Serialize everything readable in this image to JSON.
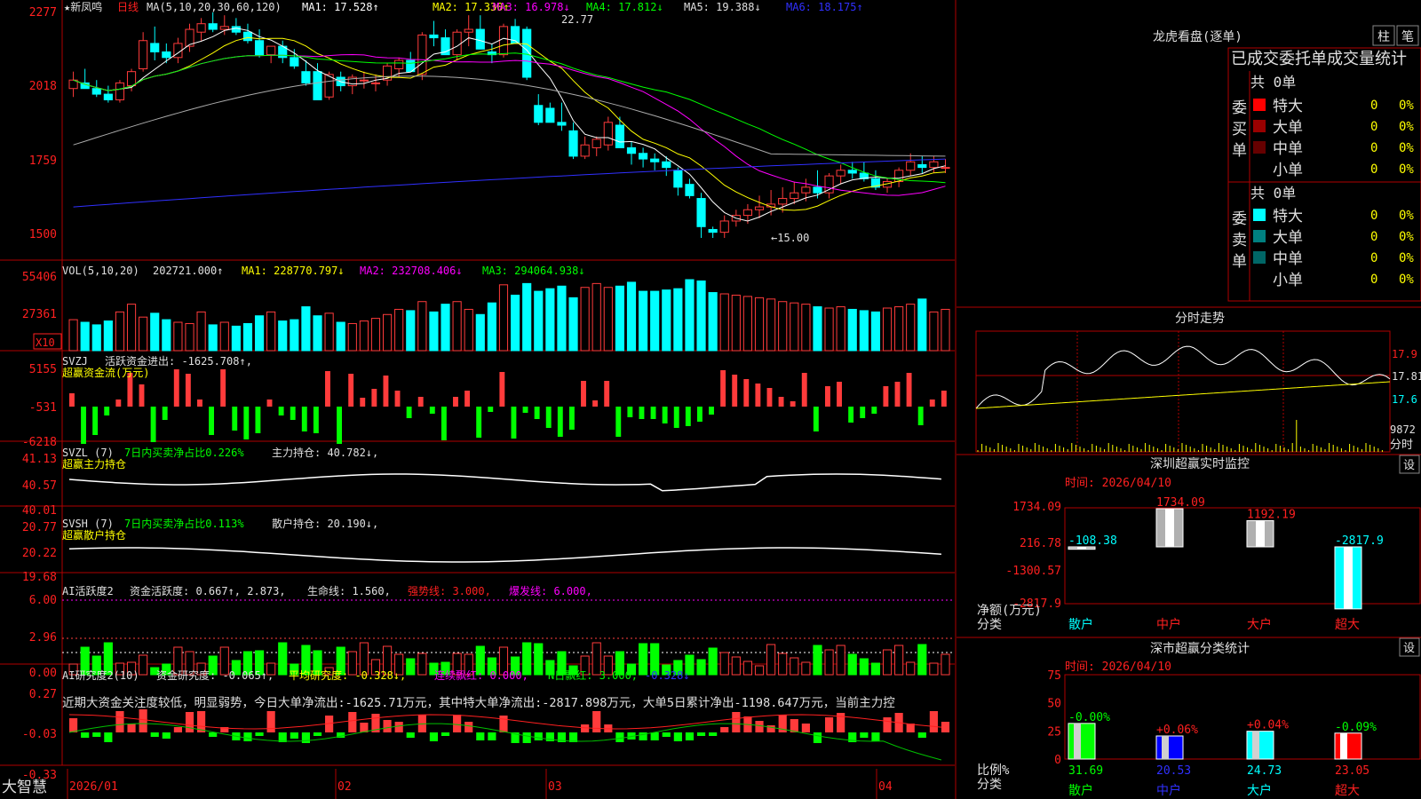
{
  "colors": {
    "up": "#ff3b3b",
    "down": "#00ffff",
    "grid": "#8b0000",
    "axis_text": "#ff2020",
    "white": "#ffffff",
    "yellow": "#ffff00",
    "magenta": "#ff00ff",
    "green": "#00ff00",
    "gray": "#aaaaaa",
    "blue": "#3030ff",
    "text": "#e0e0e0"
  },
  "stock": {
    "name": "★新凤鸣",
    "period": "日线"
  },
  "main_panel": {
    "ma_legend": [
      "MA(5,10,20,30,60,120)",
      "MA1: 17.528↑",
      "MA2: 17.330↑",
      "MA3: 16.978↓",
      "MA4: 17.812↓",
      "MA5: 19.388↓",
      "MA6: 18.175↑"
    ],
    "y_ticks": [
      "2277",
      "2018",
      "1759",
      "1500"
    ],
    "high_mark": "22.77",
    "low_mark": "←15.00"
  },
  "vol_panel": {
    "legend": [
      "VOL(5,10,20)",
      "202721.000↑",
      "MA1: 228770.797↓",
      "MA2: 232708.406↓",
      "MA3: 294064.938↓"
    ],
    "y_ticks": [
      "55406",
      "27361"
    ],
    "unit": "X10"
  },
  "svzj_panel": {
    "legend": [
      "SVZJ",
      "活跃资金进出: -1625.708↑,"
    ],
    "subtitle": "超赢资金流(万元)",
    "y_ticks": [
      "5155",
      "-531",
      "-6218"
    ]
  },
  "svzl_panel": {
    "legend": [
      "SVZL (7)",
      "7日内买卖净占比0.226%",
      "主力持仓: 40.782↓,"
    ],
    "subtitle": "超赢主力持仓",
    "y_ticks": [
      "41.13",
      "40.57",
      "40.01"
    ]
  },
  "svsh_panel": {
    "legend": [
      "SVSH (7)",
      "7日内买卖净占比0.113%",
      "散户持仓: 20.190↓,"
    ],
    "subtitle": "超赢散户持仓",
    "y_ticks": [
      "20.77",
      "20.22",
      "19.68"
    ]
  },
  "ai_active_panel": {
    "legend": [
      "AI活跃度2",
      "资金活跃度: 0.667↑, 2.873,",
      "生命线: 1.560,",
      "强势线: 3.000,",
      "爆发线: 6.000,"
    ],
    "y_ticks": [
      "6.00",
      "2.96",
      "0.00"
    ]
  },
  "ai_research_panel": {
    "legend": [
      "AI研究度2(10)",
      "资金研究度: -0.065↑,",
      "平均研究度: -0.328↓,",
      "连续飘红: 0.000,",
      "N日飘红: 3.000,",
      "-0.328↓"
    ],
    "commentary": "近期大资金关注度较低，明显弱势，今日大单净流出:-1625.71万元，其中特大单净流出:-2817.898万元，大单5日累计净出-1198.647万元，当前主力控",
    "y_ticks": [
      "0.27",
      "-0.03",
      "-0.33"
    ]
  },
  "x_axis": {
    "labels": [
      "2026/01",
      "02",
      "03",
      "04"
    ]
  },
  "footer": {
    "brand": "大智慧"
  },
  "dragon_tiger": {
    "title": "龙虎看盘(逐单)",
    "btn_bar": "柱",
    "btn_stroke": "笔",
    "header": "已成交委托单成交量统计",
    "buy": {
      "label": "委买单",
      "total": "共 0单",
      "rows": [
        {
          "name": "特大",
          "vol": "0",
          "pct": "0%",
          "color": "#ff0000"
        },
        {
          "name": "大单",
          "vol": "0",
          "pct": "0%",
          "color": "#990000"
        },
        {
          "name": "中单",
          "vol": "0",
          "pct": "0%",
          "color": "#660000"
        },
        {
          "name": "小单",
          "vol": "0",
          "pct": "0%",
          "color": "#000000"
        }
      ]
    },
    "sell": {
      "label": "委卖单",
      "total": "共 0单",
      "rows": [
        {
          "name": "特大",
          "vol": "0",
          "pct": "0%",
          "color": "#00ffff"
        },
        {
          "name": "大单",
          "vol": "0",
          "pct": "0%",
          "color": "#008080"
        },
        {
          "name": "中单",
          "vol": "0",
          "pct": "0%",
          "color": "#006666"
        },
        {
          "name": "小单",
          "vol": "0",
          "pct": "0%",
          "color": "#000000"
        }
      ]
    }
  },
  "intraday": {
    "title": "分时走势",
    "y_ticks": [
      "17.9",
      "17.81",
      "17.6"
    ],
    "vol_label": "9872",
    "x_label": "分时"
  },
  "sz_monitor": {
    "title": "深圳超赢实时监控",
    "settings": "设",
    "time": "时间: 2026/04/10",
    "y_ticks": [
      "1734.09",
      "216.78",
      "-1300.57",
      "-2817.9"
    ],
    "ylabel": "净额(万元)",
    "xlabel": "分类",
    "categories": [
      "散户",
      "中户",
      "大户",
      "超大"
    ],
    "values": [
      -108.38,
      1734.09,
      1192.19,
      -2817.9
    ],
    "value_labels": [
      "-108.38",
      "1734.09",
      "1192.19",
      "-2817.9"
    ]
  },
  "sz_class": {
    "title": "深市超赢分类统计",
    "settings": "设",
    "time": "时间: 2026/04/10",
    "y_ticks": [
      "75",
      "50",
      "25",
      "0"
    ],
    "ylabel": "比例%",
    "xlabel": "分类",
    "categories": [
      "散户",
      "中户",
      "大户",
      "超大"
    ],
    "values": [
      31.69,
      20.53,
      24.73,
      23.05
    ],
    "changes": [
      "-0.00%",
      "+0.06%",
      "+0.04%",
      "-0.09%"
    ],
    "colors": [
      "#00ff00",
      "#0000ff",
      "#00ffff",
      "#ff0000"
    ]
  },
  "chart_data": {
    "type": "candlestick",
    "title": "新凤鸣 日线",
    "ohlc": [
      [
        20.3,
        20.9,
        20.0,
        20.6
      ],
      [
        20.5,
        21.0,
        20.3,
        20.3
      ],
      [
        20.3,
        20.6,
        20.0,
        20.1
      ],
      [
        20.1,
        20.4,
        19.8,
        19.9
      ],
      [
        19.9,
        20.6,
        19.8,
        20.5
      ],
      [
        20.4,
        21.0,
        20.2,
        20.9
      ],
      [
        21.0,
        22.3,
        20.9,
        22.0
      ],
      [
        21.9,
        22.5,
        21.3,
        21.6
      ],
      [
        21.6,
        21.9,
        21.2,
        21.4
      ],
      [
        21.4,
        22.1,
        21.2,
        21.9
      ],
      [
        21.8,
        22.6,
        21.6,
        22.4
      ],
      [
        22.3,
        22.8,
        22.0,
        22.6
      ],
      [
        22.6,
        23.0,
        22.3,
        22.4
      ],
      [
        22.4,
        22.9,
        22.2,
        22.5
      ],
      [
        22.5,
        22.8,
        22.2,
        22.3
      ],
      [
        22.3,
        22.6,
        21.9,
        22.0
      ],
      [
        22.0,
        22.4,
        21.4,
        21.5
      ],
      [
        21.5,
        21.8,
        21.2,
        21.8
      ],
      [
        21.8,
        22.0,
        21.2,
        21.4
      ],
      [
        21.4,
        21.7,
        21.0,
        21.1
      ],
      [
        20.9,
        21.3,
        20.4,
        20.5
      ],
      [
        20.9,
        21.2,
        19.9,
        19.9
      ],
      [
        20.0,
        20.9,
        19.9,
        20.8
      ],
      [
        20.7,
        20.9,
        20.2,
        20.4
      ],
      [
        20.4,
        20.8,
        20.1,
        20.7
      ],
      [
        20.6,
        20.9,
        20.3,
        20.6
      ],
      [
        20.5,
        20.8,
        20.2,
        20.5
      ],
      [
        20.6,
        21.2,
        20.4,
        21.1
      ],
      [
        21.0,
        21.4,
        20.7,
        21.3
      ],
      [
        21.3,
        21.6,
        20.9,
        20.9
      ],
      [
        20.8,
        22.3,
        20.6,
        22.2
      ],
      [
        22.2,
        22.7,
        21.8,
        22.1
      ],
      [
        22.1,
        22.4,
        21.5,
        21.5
      ],
      [
        21.5,
        22.4,
        21.3,
        22.3
      ],
      [
        22.3,
        22.9,
        21.8,
        22.4
      ],
      [
        22.4,
        22.9,
        21.9,
        21.7
      ],
      [
        21.6,
        21.9,
        21.2,
        21.5
      ],
      [
        21.5,
        22.6,
        21.4,
        22.5
      ],
      [
        22.5,
        22.77,
        22.0,
        21.9
      ],
      [
        22.4,
        22.5,
        20.6,
        20.7
      ],
      [
        19.7,
        20.1,
        19.0,
        19.1
      ],
      [
        19.6,
        19.8,
        19.2,
        19.1
      ],
      [
        19.1,
        19.8,
        18.8,
        19.0
      ],
      [
        18.8,
        19.1,
        17.8,
        17.9
      ],
      [
        17.9,
        18.6,
        17.8,
        18.3
      ],
      [
        18.2,
        18.6,
        17.9,
        18.5
      ],
      [
        18.3,
        19.3,
        18.1,
        19.1
      ],
      [
        19.0,
        19.3,
        18.2,
        18.2
      ],
      [
        18.2,
        18.4,
        17.6,
        18.0
      ],
      [
        18.0,
        18.2,
        17.5,
        17.8
      ],
      [
        17.8,
        18.0,
        17.4,
        17.7
      ],
      [
        17.7,
        17.9,
        17.2,
        17.5
      ],
      [
        17.4,
        17.5,
        16.5,
        16.8
      ],
      [
        16.9,
        17.1,
        16.4,
        16.5
      ],
      [
        16.4,
        16.6,
        15.0,
        15.4
      ],
      [
        15.3,
        15.4,
        15.0,
        15.2
      ],
      [
        15.2,
        15.8,
        15.0,
        15.6
      ],
      [
        15.6,
        16.0,
        15.4,
        15.8
      ],
      [
        15.8,
        16.2,
        15.5,
        16.0
      ],
      [
        16.0,
        16.5,
        15.7,
        16.1
      ],
      [
        16.1,
        16.7,
        15.8,
        16.2
      ],
      [
        16.2,
        16.8,
        15.9,
        16.4
      ],
      [
        16.4,
        17.0,
        16.2,
        16.6
      ],
      [
        16.6,
        17.1,
        16.3,
        16.8
      ],
      [
        16.8,
        17.4,
        16.4,
        16.6
      ],
      [
        16.6,
        17.3,
        16.4,
        17.2
      ],
      [
        17.2,
        17.6,
        16.9,
        17.4
      ],
      [
        17.4,
        17.7,
        17.1,
        17.3
      ],
      [
        17.3,
        17.7,
        17.0,
        17.1
      ],
      [
        17.1,
        17.4,
        16.7,
        16.8
      ],
      [
        16.8,
        17.1,
        16.6,
        17.0
      ],
      [
        17.0,
        17.5,
        16.8,
        17.4
      ],
      [
        17.4,
        18.0,
        17.2,
        17.7
      ],
      [
        17.6,
        17.9,
        17.3,
        17.5
      ],
      [
        17.5,
        17.9,
        17.3,
        17.7
      ],
      [
        17.5,
        17.8,
        17.3,
        17.5
      ]
    ],
    "volume": [
      120,
      110,
      100,
      115,
      150,
      180,
      130,
      145,
      120,
      110,
      105,
      150,
      100,
      110,
      95,
      105,
      135,
      150,
      115,
      120,
      170,
      135,
      145,
      110,
      105,
      115,
      125,
      140,
      160,
      155,
      190,
      150,
      180,
      190,
      160,
      140,
      185,
      255,
      215,
      260,
      230,
      240,
      250,
      205,
      245,
      260,
      245,
      250,
      265,
      230,
      230,
      235,
      240,
      275,
      270,
      225,
      220,
      215,
      210,
      205,
      200,
      190,
      185,
      180,
      170,
      165,
      170,
      160,
      155,
      150,
      165,
      170,
      180,
      200,
      150,
      160
    ],
    "series_ma": {
      "ma5": "white",
      "ma10": "yellow",
      "ma20": "magenta",
      "ma30": "green",
      "ma60": "gray",
      "ma120": "blue"
    },
    "y_range": [
      15.0,
      23.0
    ]
  }
}
